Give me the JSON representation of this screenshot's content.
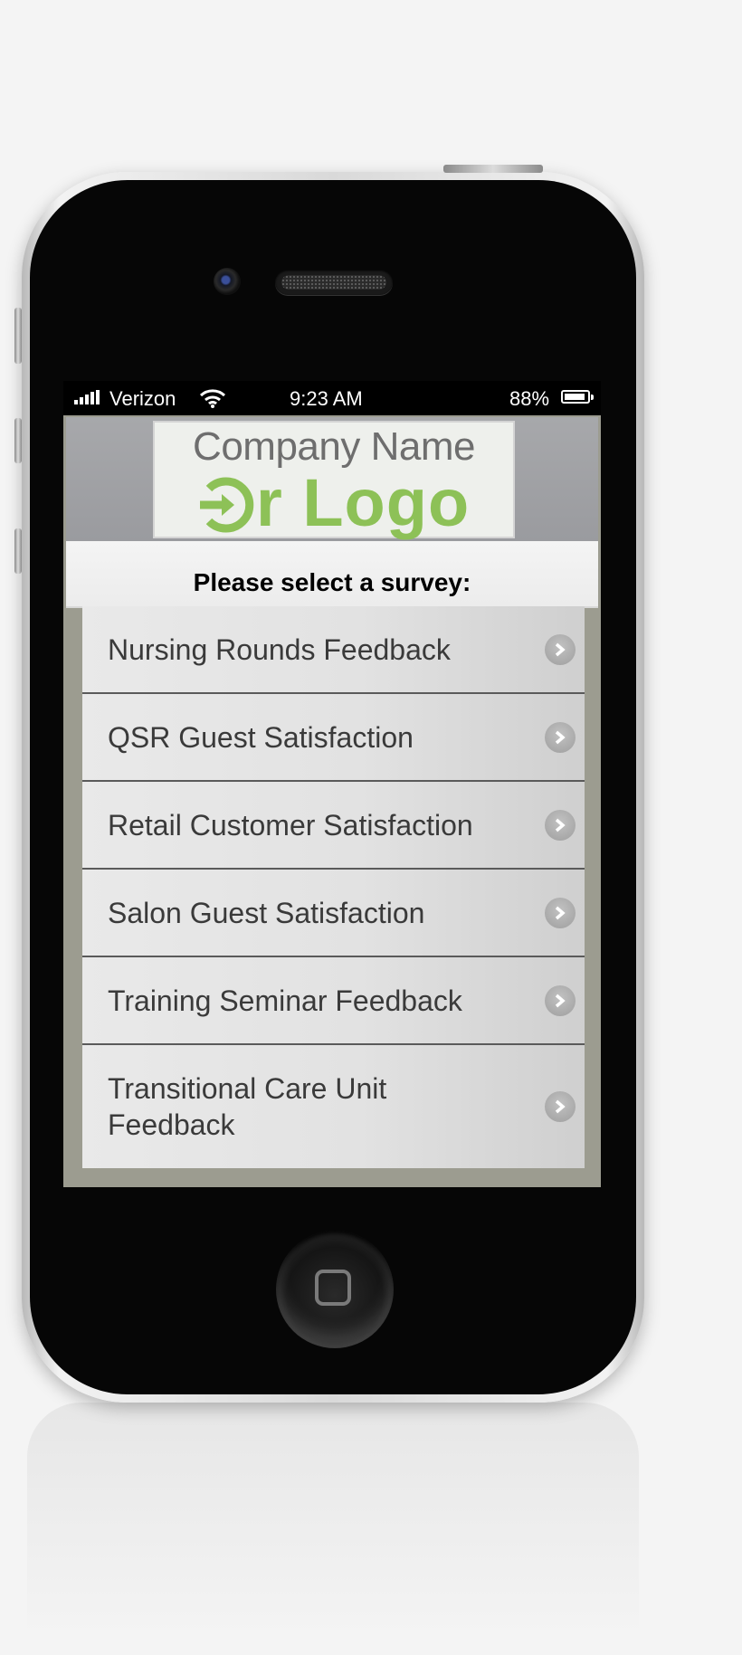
{
  "statusbar": {
    "carrier": "Verizon",
    "time": "9:23 AM",
    "battery": "88%"
  },
  "logo": {
    "line1": "Company Name",
    "line2": "r Logo"
  },
  "prompt": "Please select a survey:",
  "surveys": [
    {
      "label": "Nursing Rounds Feedback"
    },
    {
      "label": "QSR Guest Satisfaction"
    },
    {
      "label": "Retail Customer Satisfaction"
    },
    {
      "label": "Salon Guest Satisfaction"
    },
    {
      "label": "Training Seminar Feedback"
    },
    {
      "label": "Transitional Care Unit Feedback"
    }
  ],
  "colors": {
    "logo_green": "#8dc157",
    "logo_gray": "#6e6e6e"
  }
}
